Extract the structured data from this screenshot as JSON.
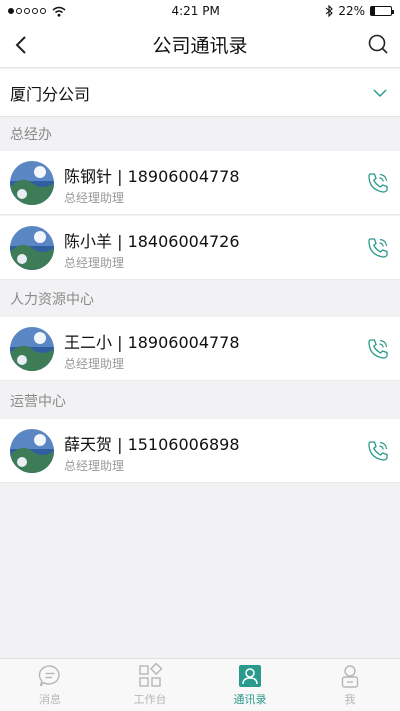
{
  "status_bar": {
    "time": "4:21 PM",
    "battery": "22%",
    "battery_level": 0.22
  },
  "nav": {
    "title": "公司通讯录"
  },
  "company": {
    "name": "厦门分公司"
  },
  "sections": [
    {
      "title": "总经办",
      "contacts": [
        {
          "name": "陈钢针 | 18906004778",
          "role": "总经理助理"
        },
        {
          "name": "陈小羊 | 18406004726",
          "role": "总经理助理"
        }
      ]
    },
    {
      "title": "人力资源中心",
      "contacts": [
        {
          "name": "王二小 | 18906004778",
          "role": "总经理助理"
        }
      ]
    },
    {
      "title": "运营中心",
      "contacts": [
        {
          "name": "薛天贺 | 15106006898",
          "role": "总经理助理"
        }
      ]
    }
  ],
  "tabs": [
    {
      "label": "消息",
      "icon": "chat-icon"
    },
    {
      "label": "工作台",
      "icon": "apps-icon"
    },
    {
      "label": "通讯录",
      "icon": "contacts-icon",
      "active": true
    },
    {
      "label": "我",
      "icon": "profile-icon"
    }
  ],
  "colors": {
    "accent": "#2a9a8c",
    "inactive": "#b6b6b6",
    "background": "#f2f2f4"
  }
}
